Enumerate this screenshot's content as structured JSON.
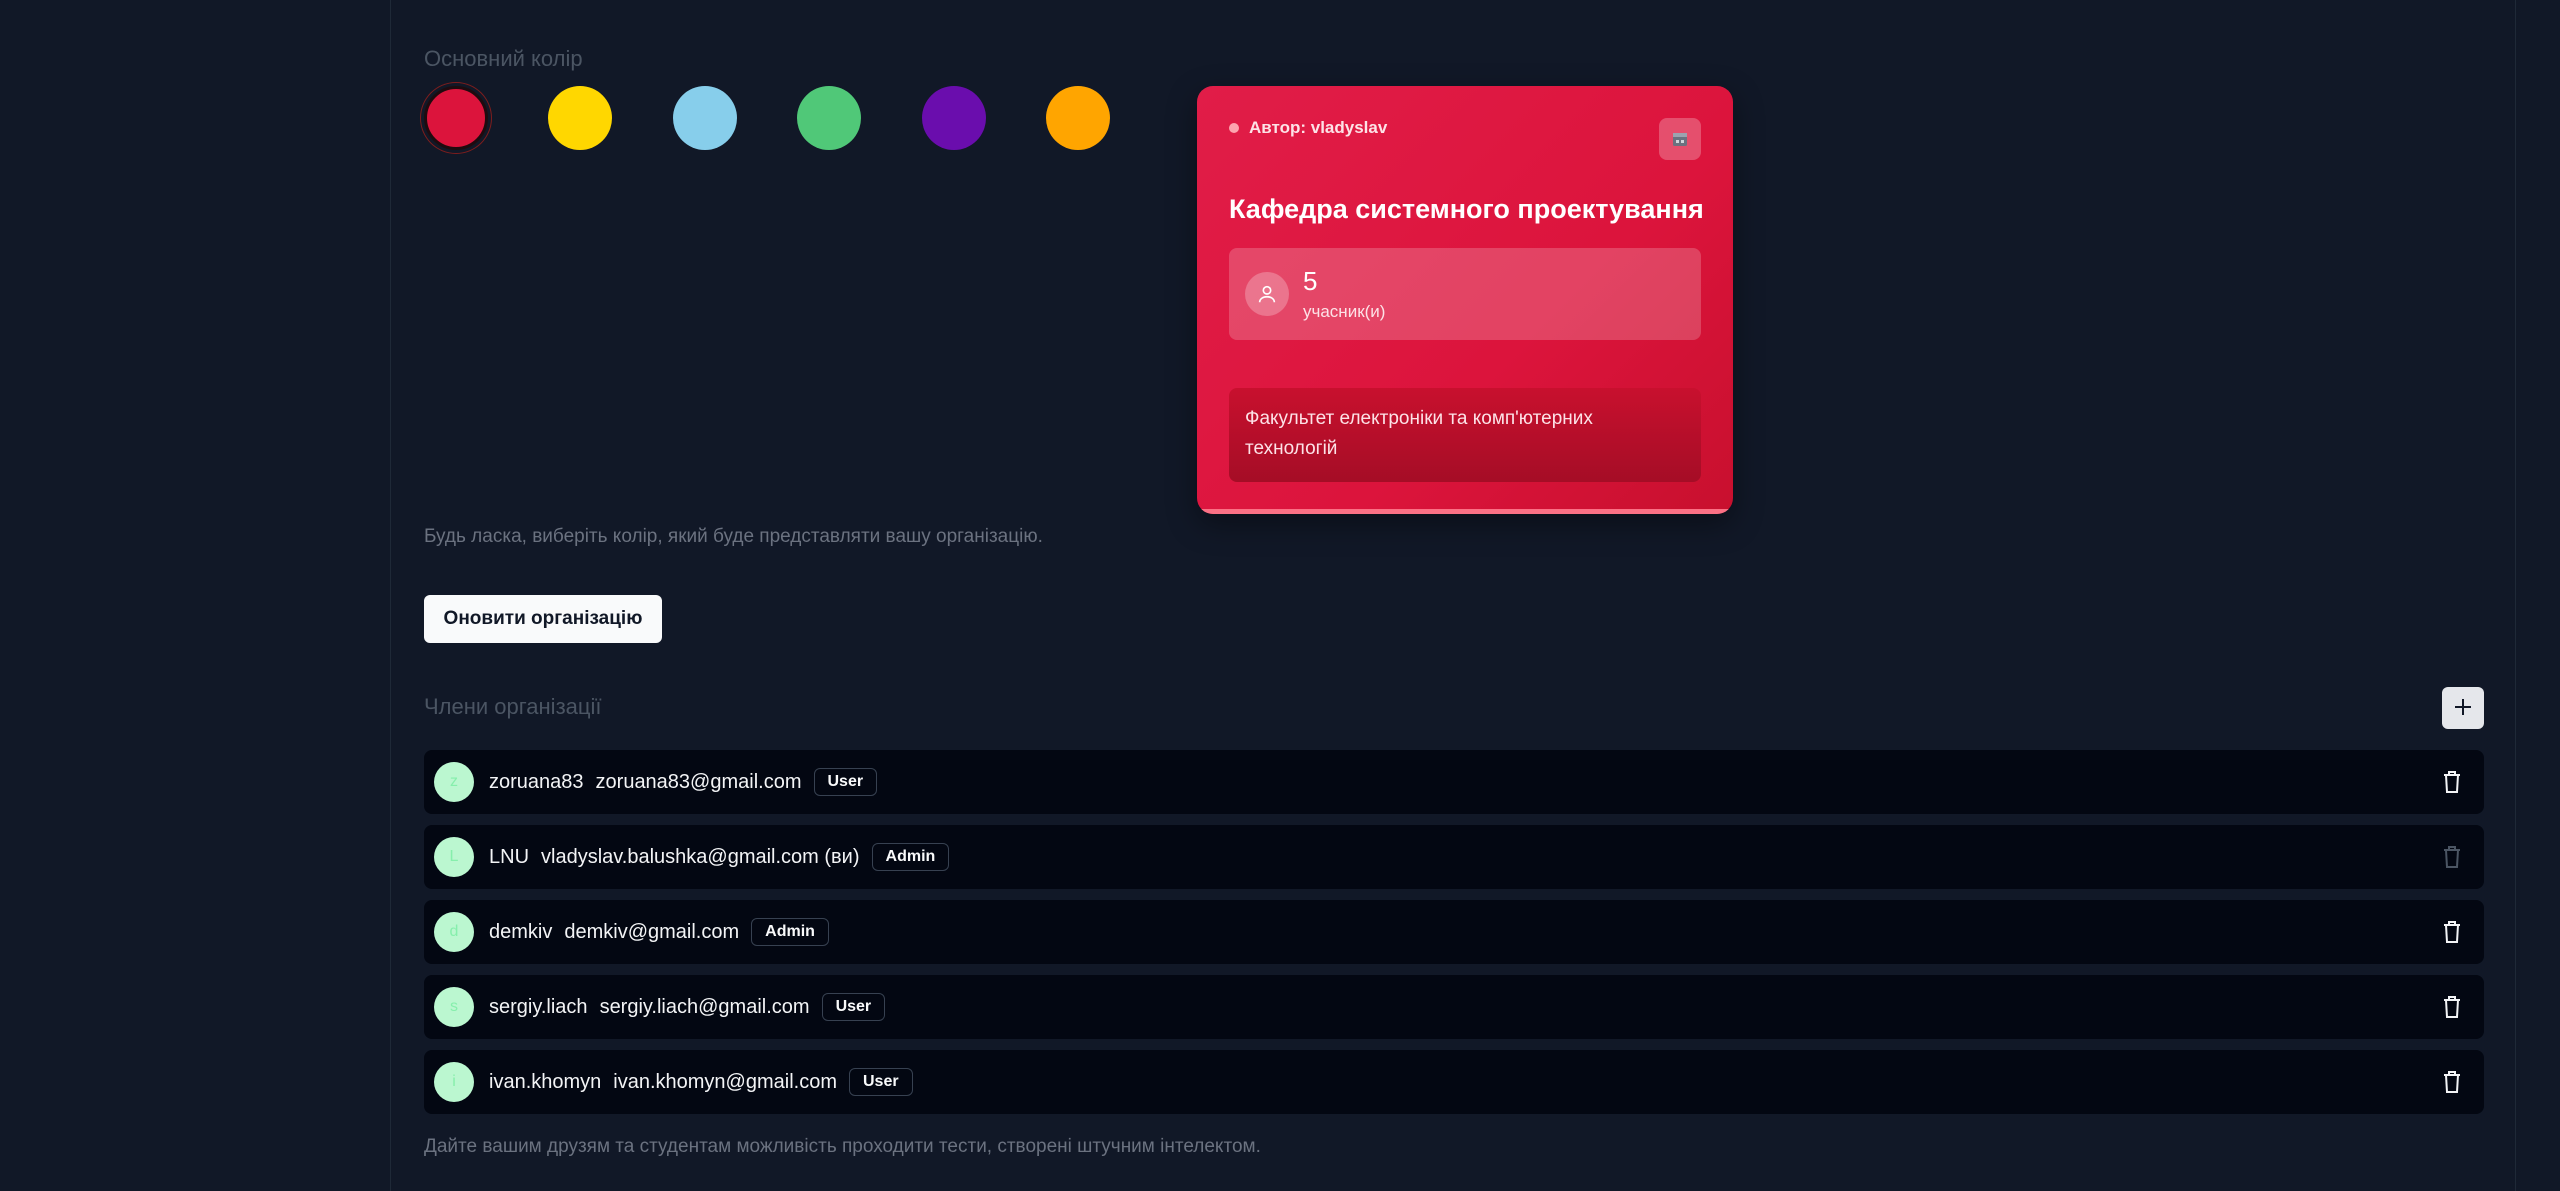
{
  "color_section": {
    "label": "Основний колір",
    "swatches": [
      {
        "name": "red",
        "color": "#dc143c",
        "selected": true
      },
      {
        "name": "yellow",
        "color": "#ffd700"
      },
      {
        "name": "light-blue",
        "color": "#87ceeb"
      },
      {
        "name": "green",
        "color": "#50c878"
      },
      {
        "name": "purple",
        "color": "#6a0dad"
      },
      {
        "name": "orange",
        "color": "#ffa500"
      }
    ],
    "helper": "Будь ласка, виберіть колір, який буде представляти вашу організацію."
  },
  "preview_card": {
    "author": "Автор: vladyslav",
    "title": "Кафедра системного проектування",
    "members_count": "5",
    "members_label": "учасник(и)",
    "faculty": "Факультет електроніки та комп'ютерних технологій",
    "accent": "#dc143c"
  },
  "update_button": "Оновити організацію",
  "members_section": {
    "label": "Члени організації",
    "add_icon": "plus-icon",
    "members": [
      {
        "initial": "z",
        "username": "zoruana83",
        "email": "zoruana83@gmail.com",
        "role": "User",
        "delete_enabled": true
      },
      {
        "initial": "L",
        "username": "LNU",
        "email": "vladyslav.balushka@gmail.com (ви)",
        "role": "Admin",
        "delete_enabled": false
      },
      {
        "initial": "d",
        "username": "demkiv",
        "email": "demkiv@gmail.com",
        "role": "Admin",
        "delete_enabled": true
      },
      {
        "initial": "s",
        "username": "sergiy.liach",
        "email": "sergiy.liach@gmail.com",
        "role": "User",
        "delete_enabled": true
      },
      {
        "initial": "i",
        "username": "ivan.khomyn",
        "email": "ivan.khomyn@gmail.com",
        "role": "User",
        "delete_enabled": true
      }
    ],
    "footer": "Дайте вашим друзям та студентам можливість проходити тести, створені штучним інтелектом."
  }
}
